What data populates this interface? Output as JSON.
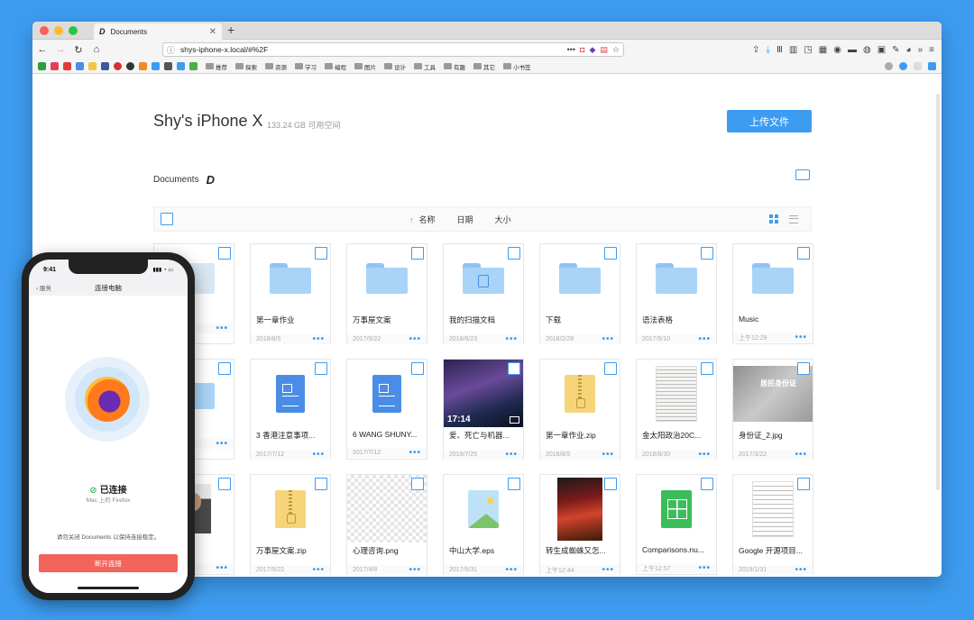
{
  "browser": {
    "tab_title": "Documents",
    "tab_favicon": "D",
    "url": "shys-iphone-x.local/#%2F",
    "bookmarks": [
      "推荐",
      "探索",
      "资源",
      "学习",
      "编程",
      "图片",
      "设计",
      "工具",
      "有趣",
      "其它",
      "小书签"
    ]
  },
  "header": {
    "device_name": "Shy's iPhone X",
    "free_space": "133.24 GB 可用空间",
    "upload_label": "上传文件"
  },
  "breadcrumb": {
    "label": "Documents",
    "logo": "D"
  },
  "sortbar": {
    "name": "名称",
    "date": "日期",
    "size": "大小"
  },
  "files": [
    {
      "name": "",
      "date": "",
      "type": "generic-folder"
    },
    {
      "name": "第一章作业",
      "date": "2018/8/5",
      "type": "folder"
    },
    {
      "name": "万事屋文案",
      "date": "2017/5/22",
      "type": "folder"
    },
    {
      "name": "我的扫描文档",
      "date": "2018/6/23",
      "type": "scan-folder"
    },
    {
      "name": "下载",
      "date": "2018/2/28",
      "type": "folder"
    },
    {
      "name": "语法表格",
      "date": "2017/5/10",
      "type": "folder"
    },
    {
      "name": "Music",
      "date": "上午12:29",
      "type": "folder"
    },
    {
      "name": "",
      "date": "",
      "type": "folder"
    },
    {
      "name": "3 香港注意事项...",
      "date": "2017/7/12",
      "type": "doc"
    },
    {
      "name": "6 WANG SHUNY...",
      "date": "2017/7/12",
      "type": "doc"
    },
    {
      "name": "爱、死亡与机器...",
      "date": "2019/7/25",
      "type": "video",
      "duration": "17:14"
    },
    {
      "name": "第一章作业.zip",
      "date": "2018/8/5",
      "type": "zip"
    },
    {
      "name": "金太阳政治20C...",
      "date": "2018/8/30",
      "type": "paper"
    },
    {
      "name": "身份证_2.jpg",
      "date": "2017/3/22",
      "type": "idcard",
      "overlay": "居民身份证"
    },
    {
      "name": "pg",
      "date": "",
      "type": "photo"
    },
    {
      "name": "万事屋文案.zip",
      "date": "2017/5/22",
      "type": "zip"
    },
    {
      "name": "心理咨询.png",
      "date": "2017/4/8",
      "type": "transparent"
    },
    {
      "name": "中山大学.eps",
      "date": "2017/5/31",
      "type": "image"
    },
    {
      "name": "转生成蜘蛛又怎...",
      "date": "上午12:44",
      "type": "comic"
    },
    {
      "name": "Comparisons.nu...",
      "date": "上午12:57",
      "type": "sheet"
    },
    {
      "name": "Google 开源项目...",
      "date": "2019/1/31",
      "type": "textdoc"
    }
  ],
  "phone": {
    "time": "9:41",
    "back_label": "服务",
    "title": "连接电脑",
    "status": "已连接",
    "sub": "Mac 上的 Firefox",
    "hint": "请勿关闭 Documents 以保持连接稳定。",
    "disconnect_label": "断开连接"
  },
  "colors": {
    "accent": "#3d9cf0",
    "danger": "#f3645a",
    "success": "#3bbd5a"
  }
}
